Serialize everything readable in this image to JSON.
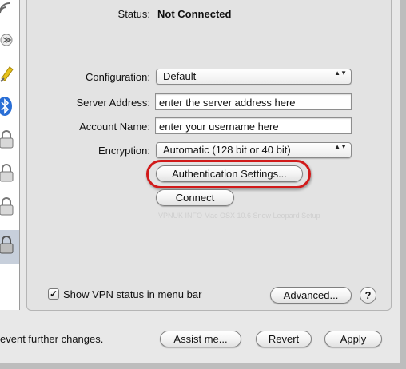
{
  "status": {
    "label": "Status:",
    "value": "Not Connected"
  },
  "form": {
    "configuration": {
      "label": "Configuration:",
      "value": "Default"
    },
    "server_address": {
      "label": "Server Address:",
      "value": "enter the server address here"
    },
    "account_name": {
      "label": "Account Name:",
      "value": "enter your username here"
    },
    "encryption": {
      "label": "Encryption:",
      "value": "Automatic (128 bit or 40 bit)"
    }
  },
  "buttons": {
    "auth_settings": "Authentication Settings...",
    "connect": "Connect",
    "advanced": "Advanced...",
    "help": "?",
    "assist": "Assist me...",
    "revert": "Revert",
    "apply": "Apply"
  },
  "watermark": "VPNUK INFO Mac OSX 10.6 Snow Leopard Setup",
  "checkbox": {
    "label": "Show VPN status in menu bar",
    "checked": true,
    "mark": "✓"
  },
  "lock_text": "event further changes.",
  "popup_arrows": "▲▼",
  "sidebar_icons": [
    "wifi-icon",
    "firewire-icon",
    "ethernet-icon",
    "bluetooth-icon",
    "lock-icon",
    "lock-icon",
    "lock-icon",
    "lock-icon"
  ],
  "colors": {
    "highlight": "#d11a1a",
    "bluetooth": "#2a6fd6",
    "ethernet": "#e6c21a"
  }
}
